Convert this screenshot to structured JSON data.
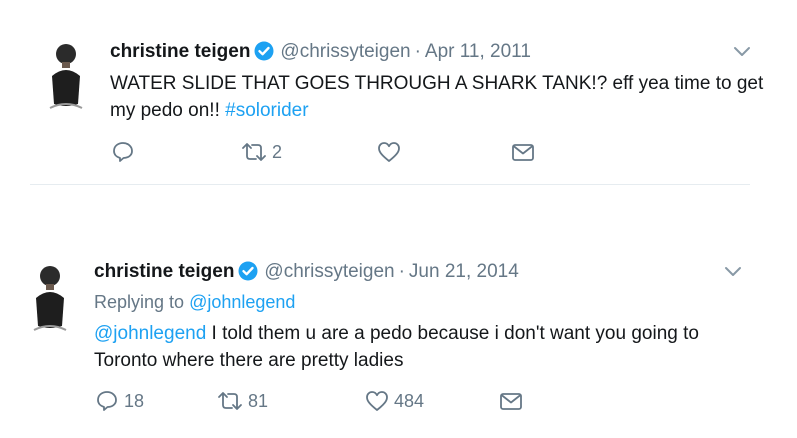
{
  "tweets": [
    {
      "name": "christine teigen",
      "handle": "@chrissyteigen",
      "separator": "·",
      "date": "Apr 11, 2011",
      "body": "WATER SLIDE THAT GOES THROUGH A SHARK TANK!? eff yea time to get my pedo on!! ",
      "hashtag": "#solorider",
      "replies": "",
      "retweets": "2",
      "likes": ""
    },
    {
      "name": "christine teigen",
      "handle": "@chrissyteigen",
      "separator": "·",
      "date": "Jun 21, 2014",
      "replying_prefix": "Replying to ",
      "replying_to": "@johnlegend",
      "mention": "@johnlegend",
      "body": " I told them u are a pedo because i don't want you going to Toronto where there are pretty ladies",
      "replies": "18",
      "retweets": "81",
      "likes": "484"
    }
  ],
  "icons": {
    "verified": "verified-badge-icon",
    "caret": "chevron-down-icon",
    "reply": "reply-icon",
    "retweet": "retweet-icon",
    "like": "heart-icon",
    "message": "envelope-icon"
  },
  "colors": {
    "link": "#1da1f2",
    "secondary_text": "#657786",
    "divider": "#e6ecf0"
  }
}
